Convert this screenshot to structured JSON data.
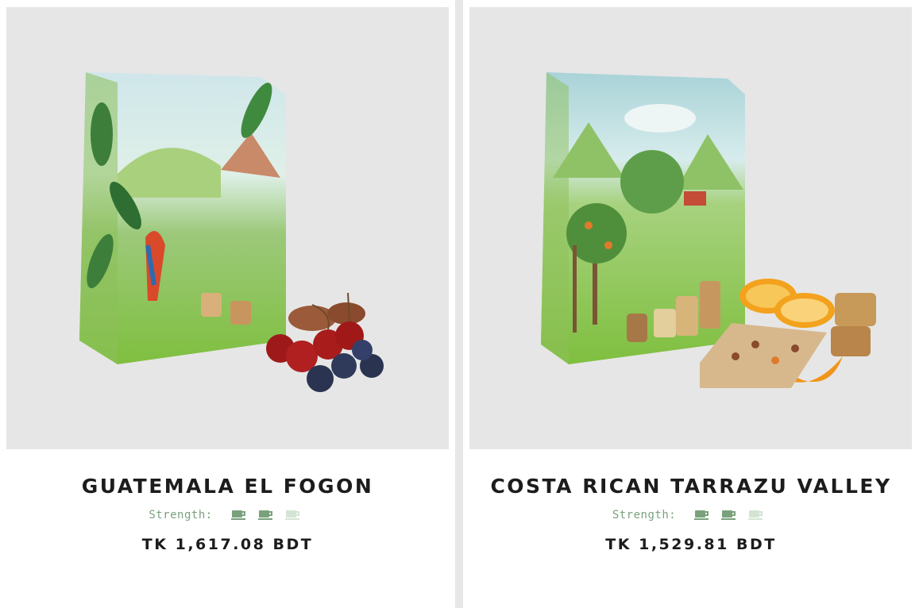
{
  "products": [
    {
      "name": "GUATEMALA EL FOGON",
      "strength_label": "Strength:",
      "strength_level": 2,
      "strength_max": 3,
      "price": "TK 1,617.08 BDT",
      "image_icon": "coffee-bag-with-cherries-and-blueberries",
      "colors": {
        "cup_active": "#7aa17c",
        "cup_inactive": "#d4e4d4"
      }
    },
    {
      "name": "COSTA RICAN TARRAZU VALLEY",
      "strength_label": "Strength:",
      "strength_level": 2,
      "strength_max": 3,
      "price": "TK 1,529.81 BDT",
      "image_icon": "coffee-bag-with-orange-and-caramel",
      "colors": {
        "cup_active": "#7aa17c",
        "cup_inactive": "#d4e4d4"
      }
    }
  ]
}
